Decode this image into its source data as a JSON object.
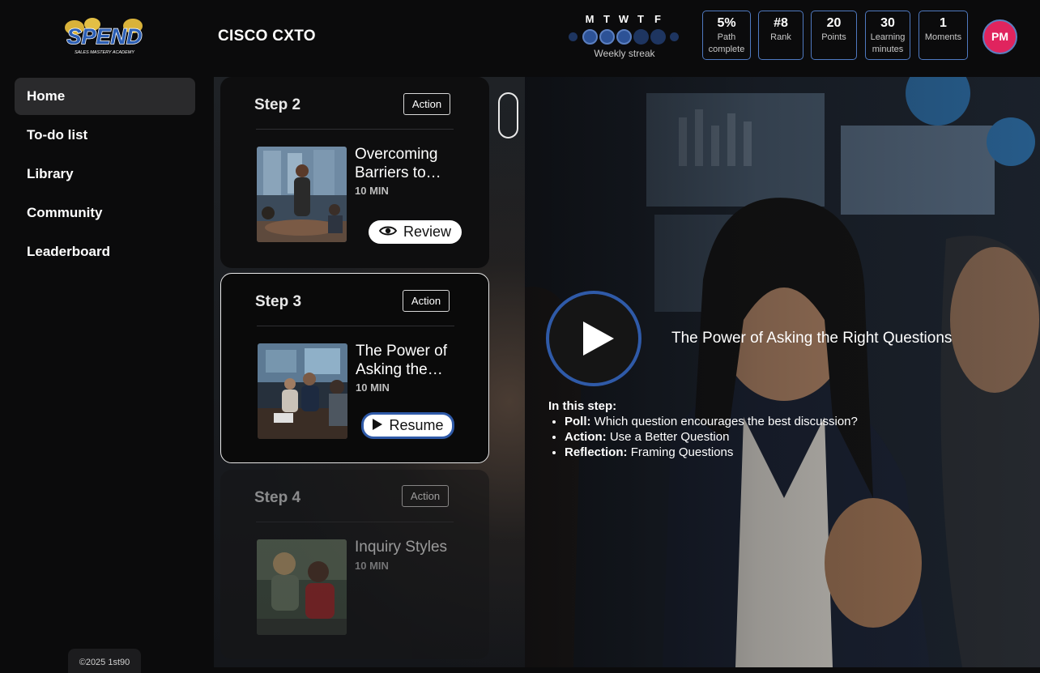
{
  "header": {
    "logo_text": "SPEND",
    "logo_subtitle": "SALES MASTERY ACADEMY",
    "title": "CISCO CXTO",
    "streak": {
      "days": [
        "M",
        "T",
        "W",
        "T",
        "F"
      ],
      "completed": [
        true,
        true,
        true,
        false,
        false
      ],
      "label": "Weekly streak"
    },
    "stats": [
      {
        "value": "5%",
        "label": "Path complete"
      },
      {
        "value": "#8",
        "label": "Rank"
      },
      {
        "value": "20",
        "label": "Points"
      },
      {
        "value": "30",
        "label": "Learning minutes"
      },
      {
        "value": "1",
        "label": "Moments"
      }
    ],
    "avatar_initials": "PM"
  },
  "sidebar": {
    "items": [
      {
        "label": "Home",
        "active": true
      },
      {
        "label": "To-do list"
      },
      {
        "label": "Library"
      },
      {
        "label": "Community"
      },
      {
        "label": "Leaderboard"
      }
    ],
    "footer": "©2025 1st90"
  },
  "steps": [
    {
      "title": "Step 2",
      "tag": "Action",
      "name": "Overcoming Barriers to…",
      "duration": "10 MIN",
      "button": "Review",
      "button_icon": "eye-icon",
      "state": "completed"
    },
    {
      "title": "Step 3",
      "tag": "Action",
      "name": "The Power of Asking the…",
      "duration": "10 MIN",
      "button": "Resume",
      "button_icon": "play-icon",
      "state": "current"
    },
    {
      "title": "Step 4",
      "tag": "Action",
      "name": "Inquiry Styles",
      "duration": "10 MIN",
      "state": "locked"
    }
  ],
  "hero": {
    "title": "The Power of Asking the Right Questions",
    "info_heading": "In this step:",
    "items": [
      {
        "label": "Poll:",
        "text": "Which question encourages the best discussion?"
      },
      {
        "label": "Action:",
        "text": "Use a Better Question"
      },
      {
        "label": "Reflection:",
        "text": "Framing Questions"
      }
    ]
  },
  "colors": {
    "accent": "#2f5aa8",
    "avatar": "#e0245e",
    "stat_border": "#4f79c0"
  }
}
